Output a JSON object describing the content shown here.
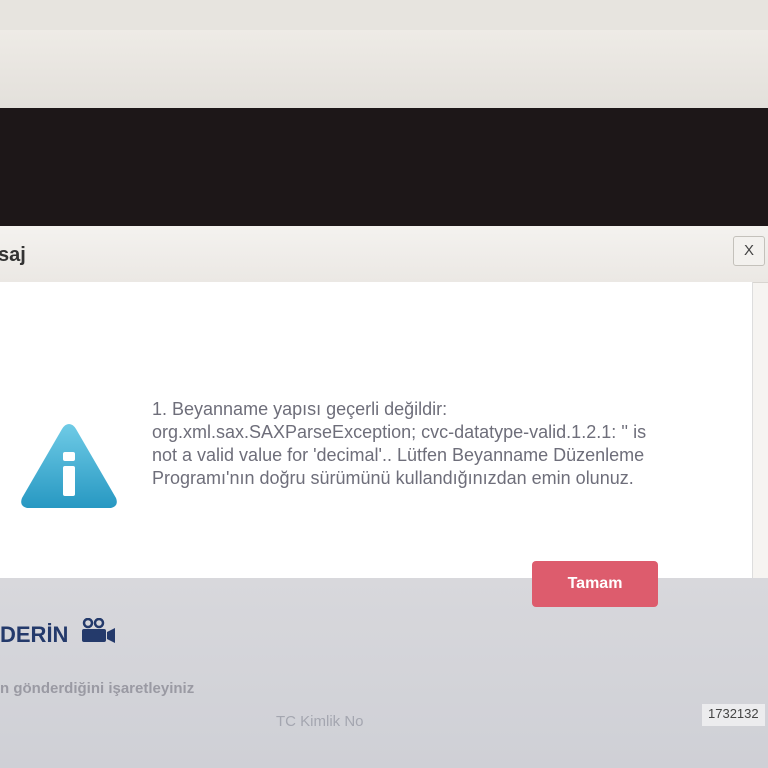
{
  "browser": {
    "url_fragment": "c0739044bcd8b6b7f4dcb23428747e28cc423cbbb4c7aa4be88f3b8"
  },
  "dialog": {
    "title": "saj",
    "close_label": "X",
    "icon": "warning-info-icon",
    "message": "1. Beyanname yapısı geçerli değildir: org.xml.sax.SAXParseException; cvc-datatype-valid.1.2.1: '' is not a valid value for 'decimal'.. Lütfen Beyanname Düzenleme Programı'nın doğru sürümünü kullandığınızdan emin olunuz.",
    "ok_label": "Tamam"
  },
  "page": {
    "heading": "DERİN",
    "heading_icon": "video-camera-icon",
    "instruction": "n gönderdiğini işaretleyiniz",
    "tc_label": "TC Kimlik No",
    "tc_value": "1732132"
  },
  "colors": {
    "ok_button": "#dd5c6d",
    "warning_icon": "#3fb0d3",
    "dark_band": "#1d1718",
    "heading": "#243a6b"
  }
}
